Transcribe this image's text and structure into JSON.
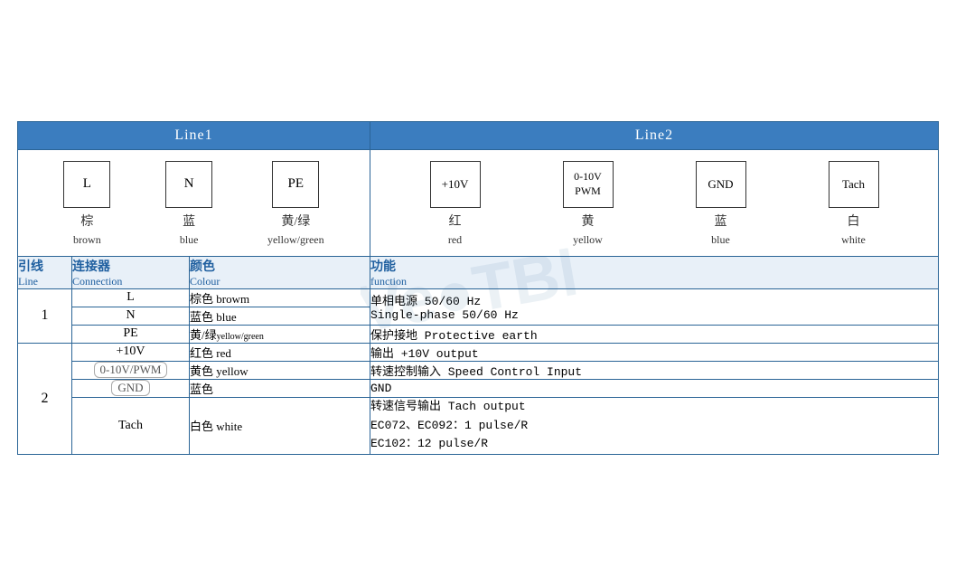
{
  "headers": {
    "line1": "Line1",
    "line2": "Line2"
  },
  "line1_connectors": [
    {
      "label": "L",
      "cn": "棕",
      "en": "brown"
    },
    {
      "label": "N",
      "cn": "蓝",
      "en": "blue"
    },
    {
      "label": "PE",
      "cn": "黄/绿",
      "en": "yellow/green"
    }
  ],
  "line2_connectors": [
    {
      "label": "+10V",
      "cn": "红",
      "en": "red"
    },
    {
      "label": "0-10V\nPWM",
      "cn": "黄",
      "en": "yellow"
    },
    {
      "label": "GND",
      "cn": "蓝",
      "en": "blue"
    },
    {
      "label": "Tach",
      "cn": "白",
      "en": "white"
    }
  ],
  "table_headers": {
    "line_cn": "引线",
    "line_en": "Line",
    "connection_cn": "连接器",
    "connection_en": "Connection",
    "colour_cn": "颜色",
    "colour_en": "Colour",
    "function_cn": "功能",
    "function_en": "function"
  },
  "rows_line1": [
    {
      "connection": "L",
      "colour_cn": "棕色",
      "colour_en": "browm",
      "function": "单相电源 50/60 Hz\nSingle-phase 50/60 Hz"
    },
    {
      "connection": "N",
      "colour_cn": "蓝色",
      "colour_en": "blue",
      "function": ""
    },
    {
      "connection": "PE",
      "colour_cn": "黄/绿",
      "colour_en": "yellow/green",
      "colour_small": true,
      "function": "保护接地 Protective earth"
    }
  ],
  "rows_line2": [
    {
      "connection": "+10V",
      "colour_cn": "红色",
      "colour_en": "red",
      "function": "输出 +10V output"
    },
    {
      "connection": "0-10V/PWM",
      "colour_cn": "黄色",
      "colour_en": "yellow",
      "function": "转速控制输入 Speed Control Input",
      "conn_rounded": true
    },
    {
      "connection": "GND",
      "colour_cn": "蓝色",
      "colour_en": "",
      "function": "GND",
      "conn_rounded": true
    },
    {
      "connection": "Tach",
      "colour_cn": "白色",
      "colour_en": "white",
      "function": "转速信号输出 Tach output\nEC072、EC092：1 pulse/R\nEC102：12 pulse/R"
    }
  ]
}
